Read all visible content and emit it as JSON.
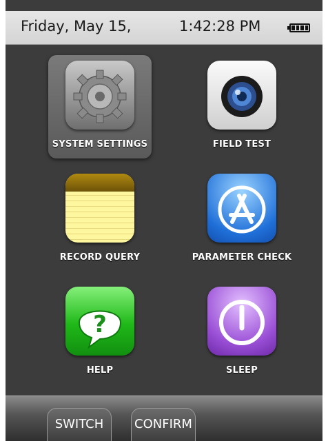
{
  "status": {
    "date": "Friday, May 15,",
    "time": "1:42:28 PM",
    "battery_icon": "battery-full-icon"
  },
  "apps": [
    {
      "label": "SYSTEM SETTINGS",
      "icon": "gear-icon",
      "selected": true
    },
    {
      "label": "FIELD TEST",
      "icon": "camera-icon"
    },
    {
      "label": "RECORD QUERY",
      "icon": "notepad-icon"
    },
    {
      "label": "PARAMETER CHECK",
      "icon": "app-store-icon"
    },
    {
      "label": "HELP",
      "icon": "help-icon"
    },
    {
      "label": "SLEEP",
      "icon": "power-icon"
    }
  ],
  "softkeys": {
    "left": "SWITCH",
    "right": "CONFIRM"
  },
  "colors": {
    "screen_bg": "#3c3c3c",
    "status_bg": "#dedede",
    "label_text": "#ffffff"
  }
}
